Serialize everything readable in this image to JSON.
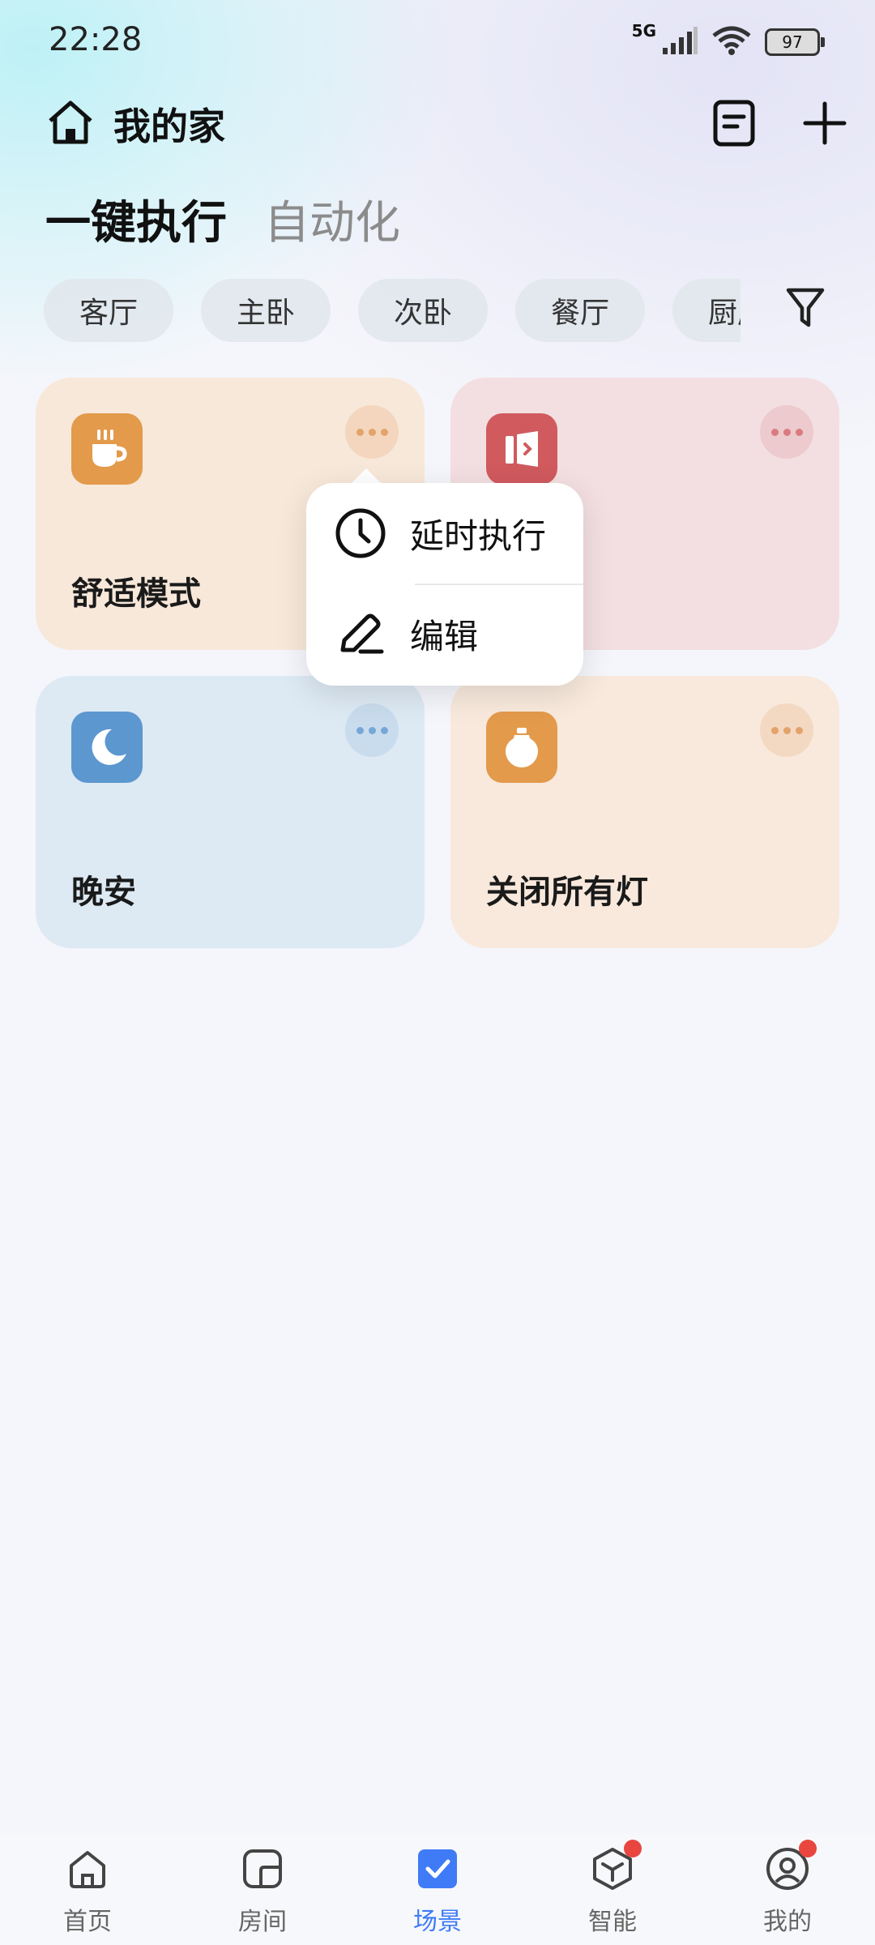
{
  "status_bar": {
    "time": "22:28",
    "network": "5G",
    "battery": "97"
  },
  "header": {
    "title": "我的家",
    "icons": {
      "home": "home-icon",
      "log": "document-icon",
      "add": "plus-icon"
    }
  },
  "tabs": [
    {
      "label": "一键执行",
      "active": true
    },
    {
      "label": "自动化",
      "active": false
    }
  ],
  "rooms": [
    "客厅",
    "主卧",
    "次卧",
    "餐厅",
    "厨房"
  ],
  "scenes": [
    {
      "title": "舒适模式",
      "icon": "coffee-cup-icon",
      "color": "#e39a4b",
      "bg": "#f8e8da"
    },
    {
      "title": "",
      "icon": "door-icon",
      "color": "#d05a5e",
      "bg": "#f3dfe1"
    },
    {
      "title": "晚安",
      "icon": "moon-icon",
      "color": "#5c97cf",
      "bg": "#dde9f3"
    },
    {
      "title": "关闭所有灯",
      "icon": "bulb-icon",
      "color": "#e39a4b",
      "bg": "#f8e9dc"
    }
  ],
  "popup_menu": [
    {
      "label": "延时执行",
      "icon": "clock-icon"
    },
    {
      "label": "编辑",
      "icon": "pen-icon"
    }
  ],
  "bottom_nav": [
    {
      "label": "首页",
      "icon": "home-icon",
      "active": false,
      "badge": false
    },
    {
      "label": "房间",
      "icon": "room-icon",
      "active": false,
      "badge": false
    },
    {
      "label": "场景",
      "icon": "scene-check-icon",
      "active": true,
      "badge": false
    },
    {
      "label": "智能",
      "icon": "cube-icon",
      "active": false,
      "badge": true
    },
    {
      "label": "我的",
      "icon": "user-icon",
      "active": false,
      "badge": true
    }
  ],
  "colors": {
    "accent": "#3f7bf6",
    "badge": "#e8463f"
  }
}
